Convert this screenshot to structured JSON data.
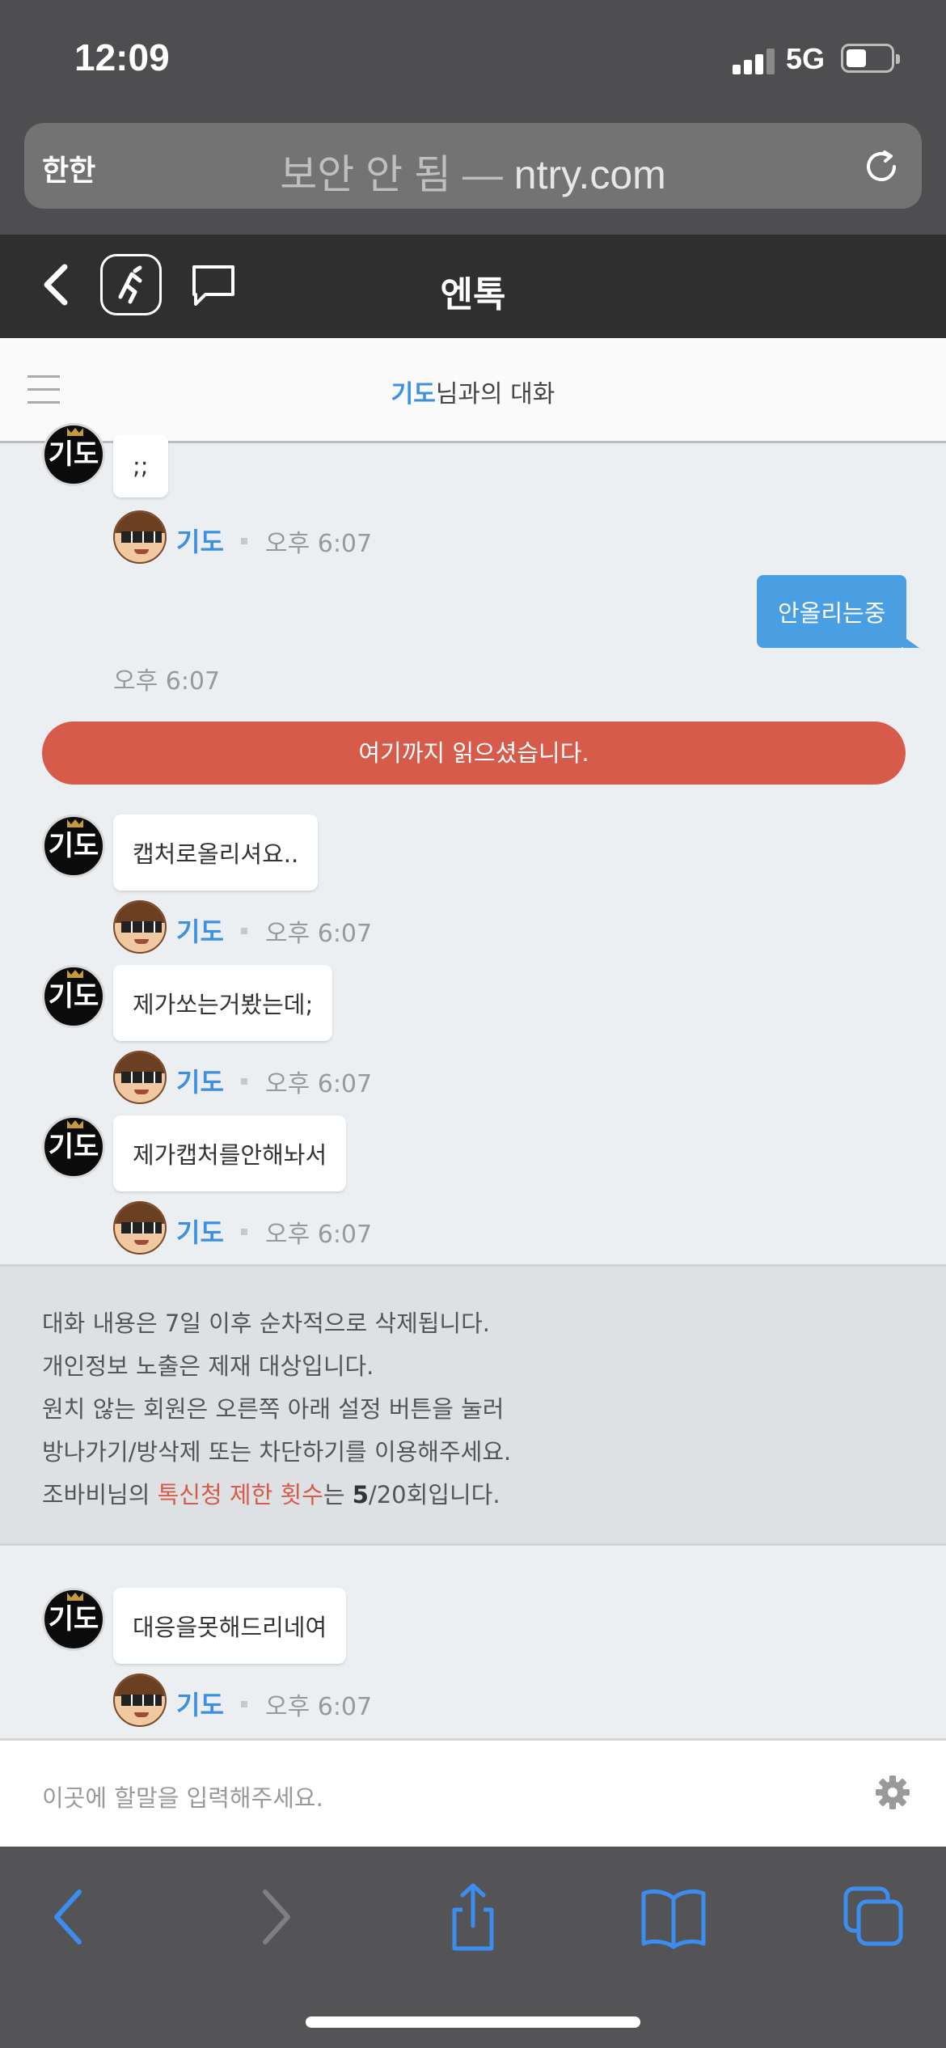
{
  "status_bar": {
    "time": "12:09",
    "network": "5G"
  },
  "url_bar": {
    "aa": "한한",
    "security": "보안 안 됨 —",
    "domain": "ntry.com"
  },
  "app_header": {
    "title": "엔톡"
  },
  "chat_header": {
    "partner": "기도",
    "suffix": "님과의 대화"
  },
  "avatar_text": "기도",
  "messages": {
    "m0": {
      "text": ";;",
      "nick": "기도",
      "time": "오후 6:07"
    },
    "mine": {
      "text": "안올리는중",
      "time": "오후 6:07"
    },
    "read_marker": "여기까지 읽으셨습니다.",
    "m1": {
      "text": "캡처로올리셔요..",
      "nick": "기도",
      "time": "오후 6:07"
    },
    "m2": {
      "text": "제가쏘는거봤는데;",
      "nick": "기도",
      "time": "오후 6:07"
    },
    "m3": {
      "text": "제가캡처를안해놔서",
      "nick": "기도",
      "time": "오후 6:07"
    },
    "m4": {
      "text": "대응을못해드리네여",
      "nick": "기도",
      "time": "오후 6:07"
    }
  },
  "notice": {
    "line1": "대화 내용은 7일 이후 순차적으로 삭제됩니다.",
    "line2": "개인정보 노출은 제재 대상입니다.",
    "line3": "원치 않는 회원은 오른쪽 아래 설정 버튼을 눌러",
    "line4": "방나가기/방삭제 또는 차단하기를 이용해주세요.",
    "line5_prefix": "조바비님의 ",
    "line5_red": "톡신청 제한 횟수",
    "line5_mid": "는 ",
    "line5_count": "5",
    "line5_suffix": "/20회입니다."
  },
  "input": {
    "placeholder": "이곳에 할말을 입력해주세요."
  },
  "colors": {
    "accent": "#3d8fe0",
    "my_bubble": "#4a9fe3",
    "read_marker": "#d65b4a",
    "toolbar_icon": "#3b8ef0"
  }
}
